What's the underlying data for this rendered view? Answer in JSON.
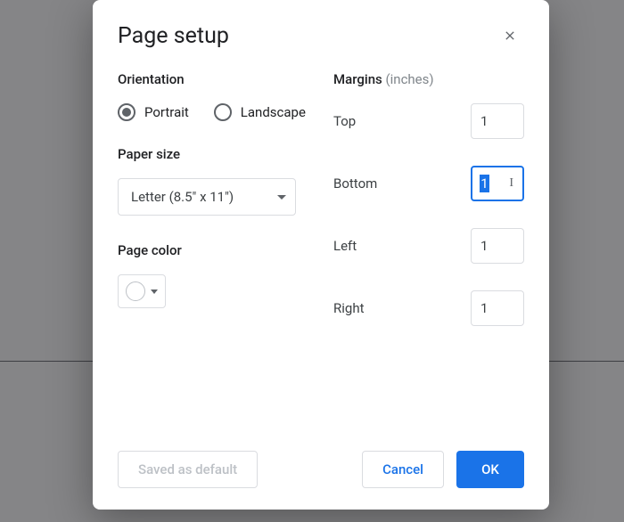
{
  "dialog": {
    "title": "Page setup",
    "orientation": {
      "label": "Orientation",
      "options": {
        "portrait": "Portrait",
        "landscape": "Landscape"
      },
      "selected": "portrait"
    },
    "paper_size": {
      "label": "Paper size",
      "value": "Letter (8.5\" x 11\")"
    },
    "page_color": {
      "label": "Page color",
      "value": "#ffffff"
    },
    "margins": {
      "label": "Margins",
      "unit_label": "(inches)",
      "top": {
        "label": "Top",
        "value": "1"
      },
      "bottom": {
        "label": "Bottom",
        "value": "1",
        "focused": true
      },
      "left": {
        "label": "Left",
        "value": "1"
      },
      "right": {
        "label": "Right",
        "value": "1"
      }
    },
    "buttons": {
      "set_default": "Saved as default",
      "cancel": "Cancel",
      "ok": "OK"
    }
  }
}
